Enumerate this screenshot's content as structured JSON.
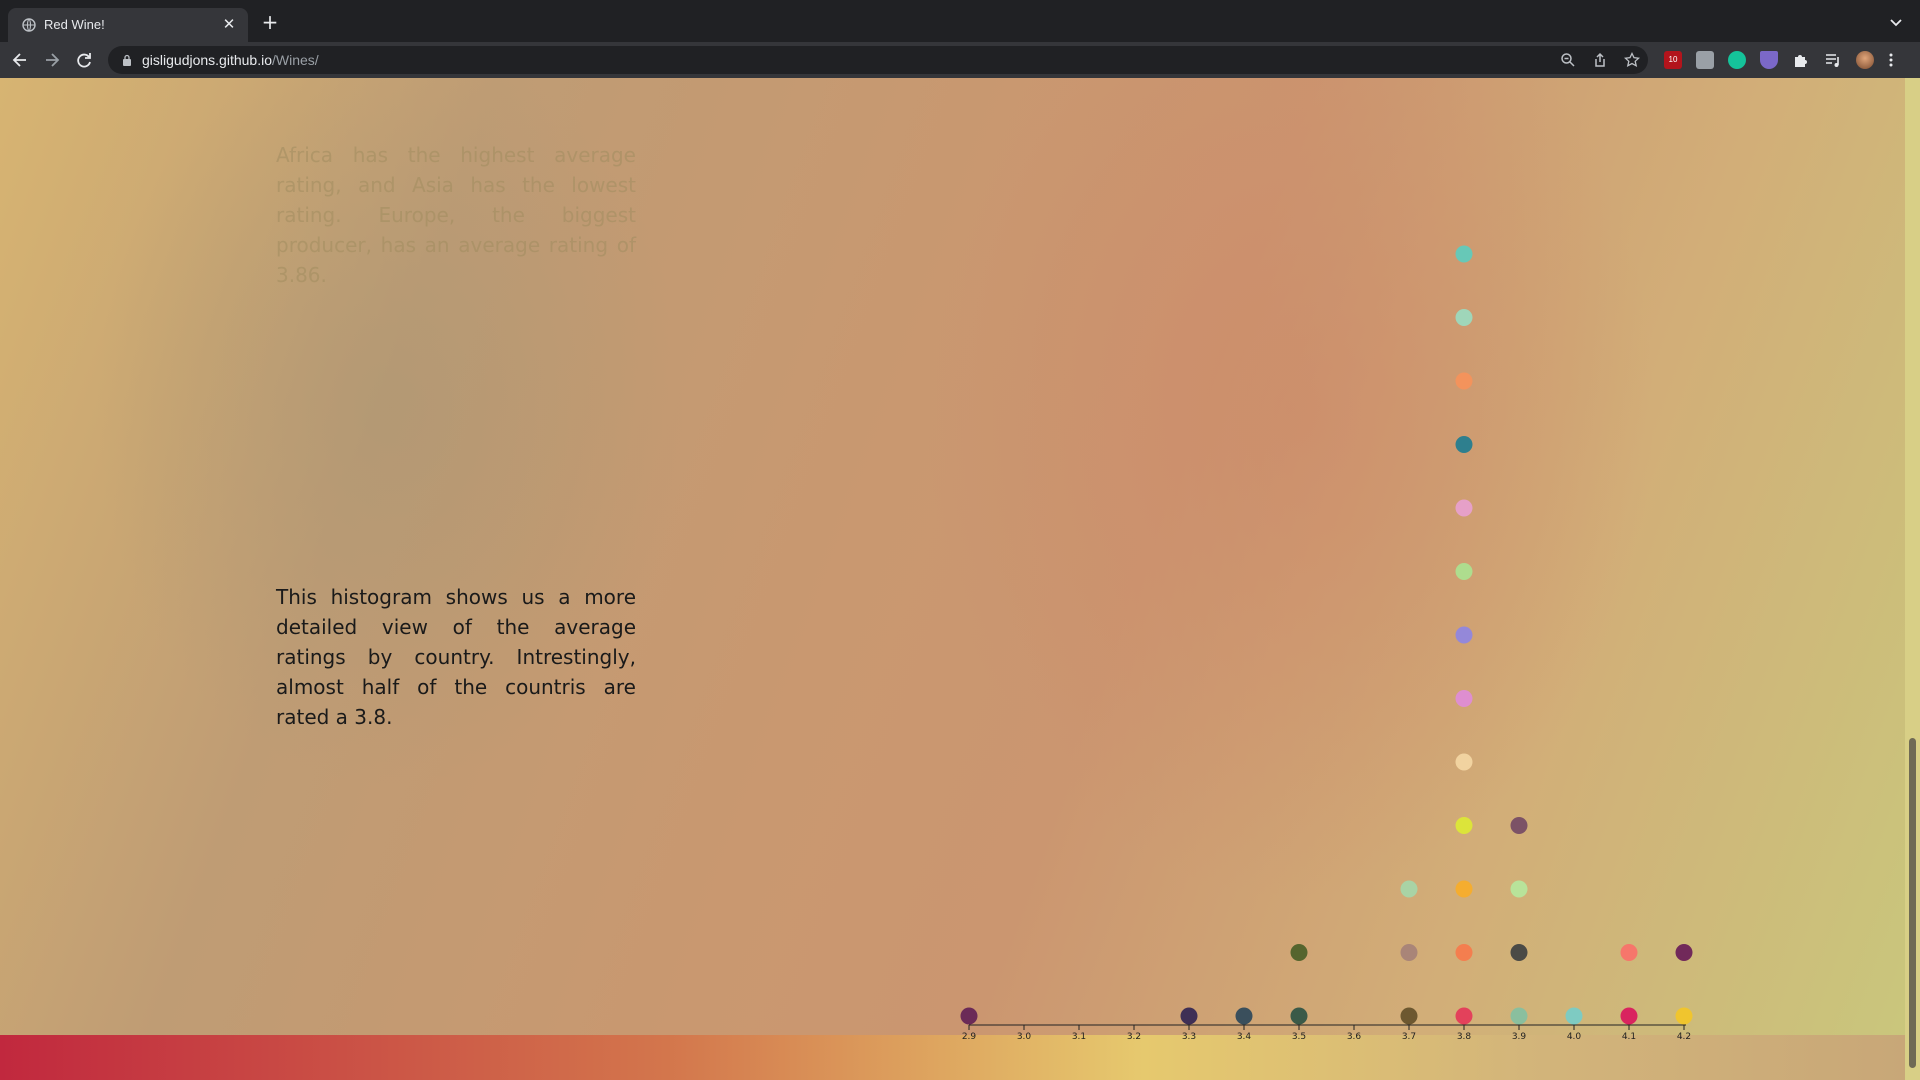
{
  "browser": {
    "tab_title": "Red Wine!",
    "url_host": "gisligudjons.github.io",
    "url_path": "/Wines/",
    "ext_badge": "10"
  },
  "page": {
    "faded_paragraph": "Africa has the highest average rating, and Asia has the lowest rating. Europe, the biggest producer, has an average rating of 3.86.",
    "main_paragraph": "This histogram shows us a more detailed view of the average ratings by country. Intrestingly, almost half of the countris are rated a 3.8."
  },
  "chart_data": {
    "type": "scatter",
    "xlabel": "",
    "ylabel": "",
    "x_ticks": [
      "2.9",
      "3.0",
      "3.1",
      "3.2",
      "3.3",
      "3.4",
      "3.5",
      "3.6",
      "3.7",
      "3.8",
      "3.9",
      "4.0",
      "4.1",
      "4.2"
    ],
    "xlim": [
      2.9,
      4.2
    ],
    "bins": [
      {
        "x": 2.9,
        "count": 1,
        "colors": [
          "#6b2a57"
        ]
      },
      {
        "x": 3.3,
        "count": 1,
        "colors": [
          "#3f2f55"
        ]
      },
      {
        "x": 3.4,
        "count": 1,
        "colors": [
          "#3a4f5c"
        ]
      },
      {
        "x": 3.5,
        "count": 2,
        "colors": [
          "#3b5a48",
          "#55652e"
        ]
      },
      {
        "x": 3.7,
        "count": 3,
        "colors": [
          "#6d5830",
          "#a98578",
          "#a9d3a5"
        ]
      },
      {
        "x": 3.8,
        "count": 13,
        "colors": [
          "#e3415b",
          "#f47e4f",
          "#f5ad2f",
          "#dce43a",
          "#f1d3a0",
          "#de8ed0",
          "#9488d9",
          "#aedd8e",
          "#e6a0c8",
          "#2e7f8e",
          "#f3935c",
          "#9fd6b9",
          "#67c8b7"
        ]
      },
      {
        "x": 3.9,
        "count": 4,
        "colors": [
          "#8abf9e",
          "#4a4a46",
          "#b8e39a",
          "#7c5266"
        ]
      },
      {
        "x": 4.0,
        "count": 1,
        "colors": [
          "#7ecbc2"
        ]
      },
      {
        "x": 4.1,
        "count": 2,
        "colors": [
          "#d9245f",
          "#f6766b"
        ]
      },
      {
        "x": 4.2,
        "count": 2,
        "colors": [
          "#f0c52e",
          "#71295a"
        ]
      }
    ]
  }
}
